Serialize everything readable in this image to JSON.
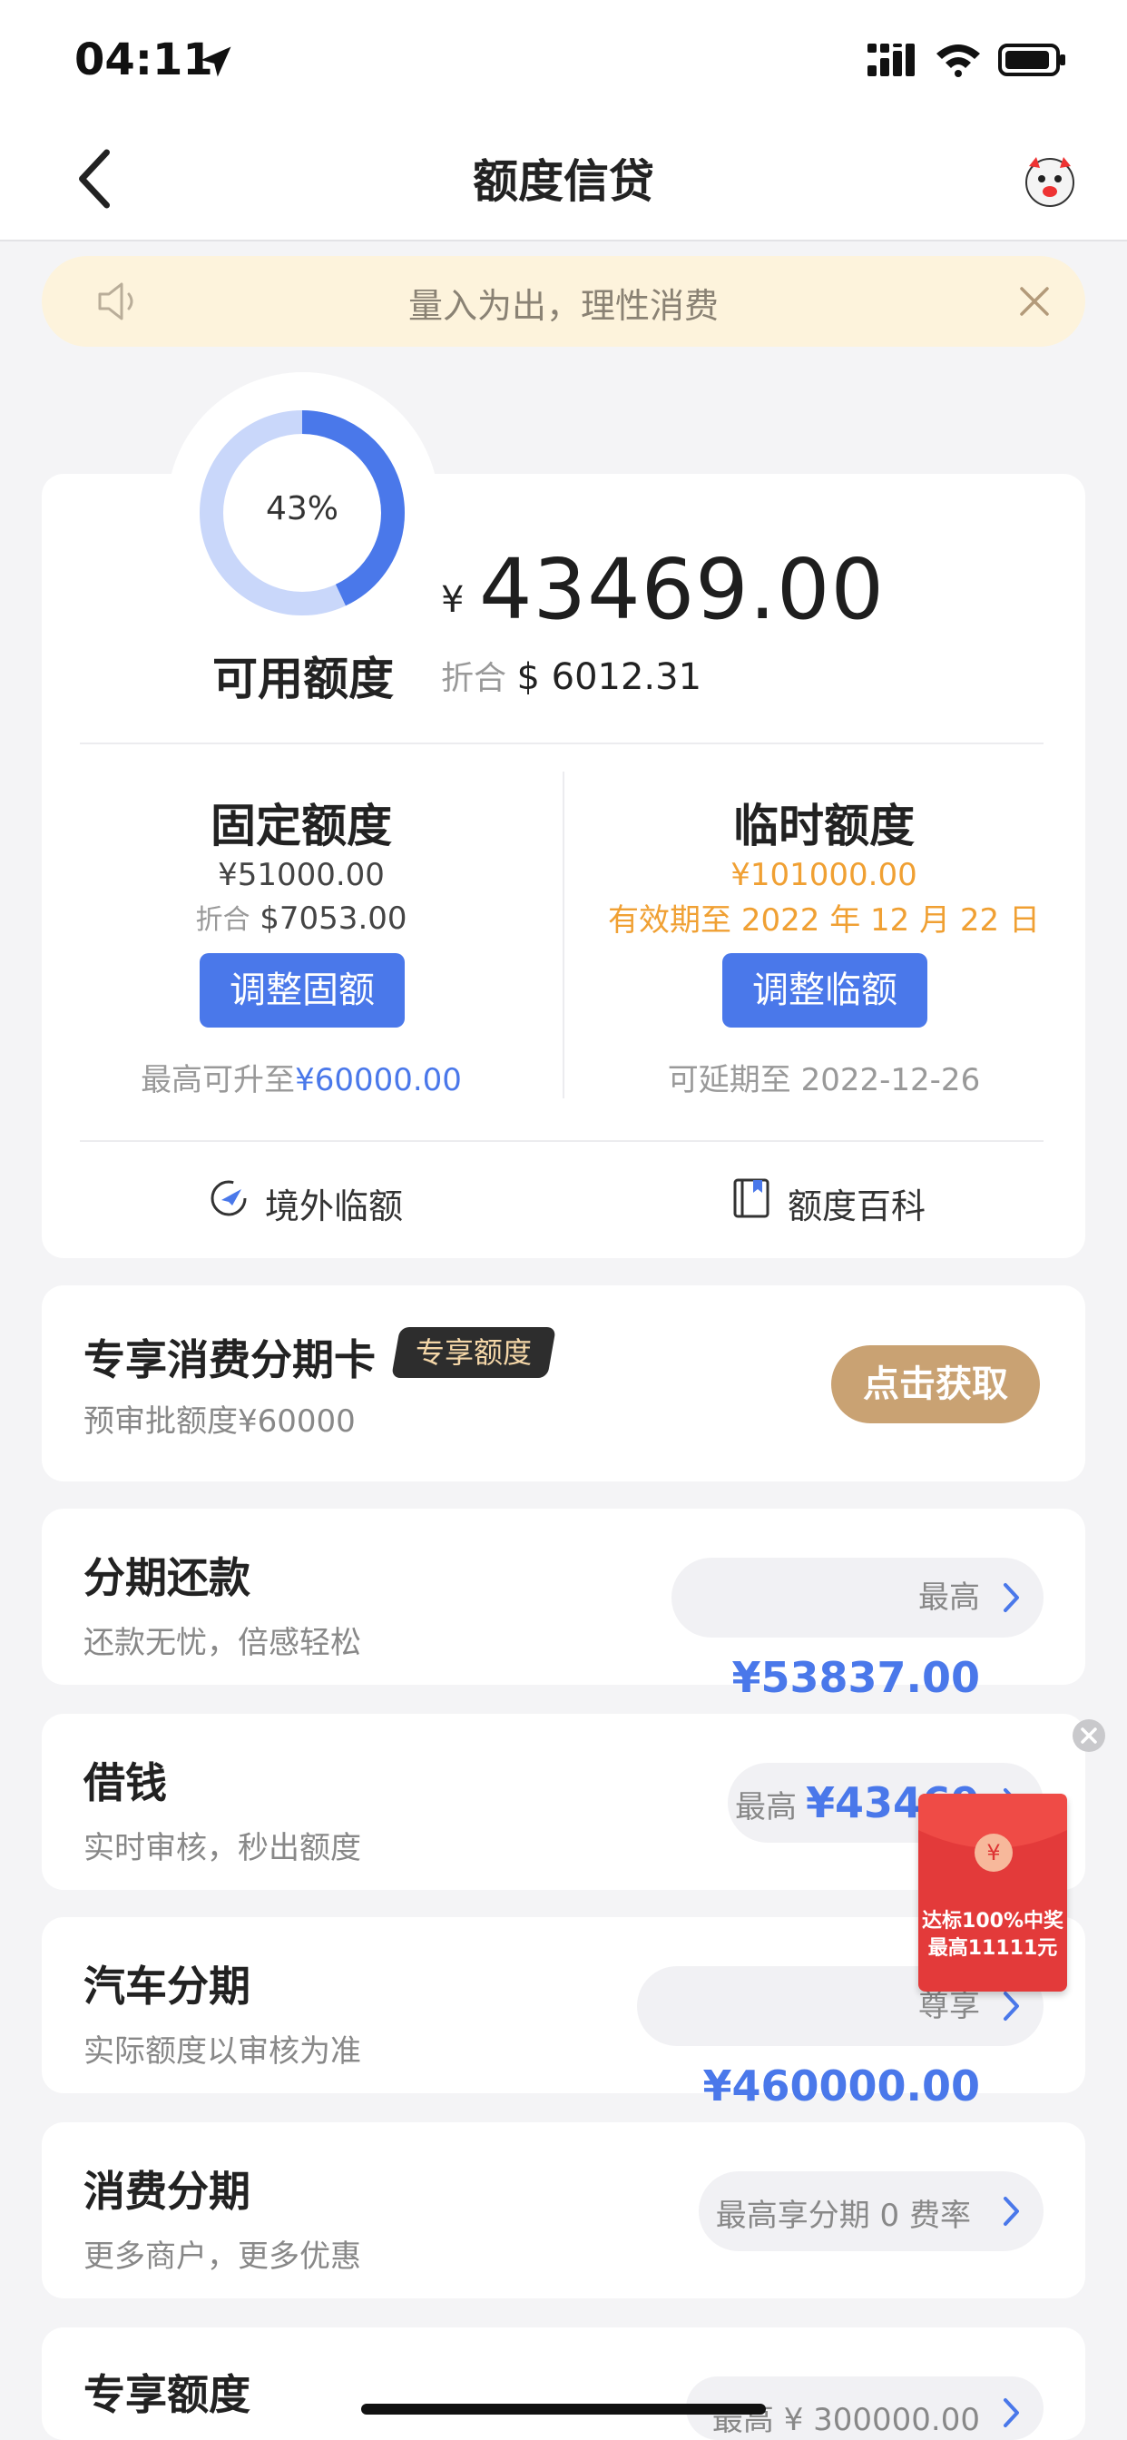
{
  "status_bar": {
    "time": "04:11"
  },
  "nav": {
    "title": "额度信贷"
  },
  "notice": {
    "text": "量入为出，理性消费"
  },
  "credit": {
    "percent_label": "43%",
    "percent_value": 0.43,
    "available_label": "可用额度",
    "currency_symbol": "¥",
    "available_amount": "43469.00",
    "fold_label": "折合",
    "fold_value": "$ 6012.31",
    "fixed": {
      "title": "固定额度",
      "amount": "¥51000.00",
      "fold_label": "折合",
      "fold_value": "$7053.00",
      "button": "调整固额",
      "foot_prefix": "最高可升至",
      "foot_value": "¥60000.00"
    },
    "temp": {
      "title": "临时额度",
      "amount": "¥101000.00",
      "validity": "有效期至 2022 年 12 月 22 日",
      "button": "调整临额",
      "foot": "可延期至 2022-12-26"
    },
    "links": {
      "overseas": "境外临额",
      "wiki": "额度百科"
    }
  },
  "exclusive_card": {
    "title": "专享消费分期卡",
    "badge": "专享额度",
    "sub": "预审批额度¥60000",
    "button": "点击获取"
  },
  "rows": [
    {
      "title": "分期还款",
      "sub": "还款无忧，倍感轻松",
      "pill_prefix": "最高",
      "pill_value": "¥53837.00"
    },
    {
      "title": "借钱",
      "sub": "实时审核，秒出额度",
      "pill_prefix": "最高",
      "pill_value": "¥43469"
    },
    {
      "title": "汽车分期",
      "sub": "实际额度以审核为准",
      "pill_prefix": "尊享",
      "pill_value": "¥460000.00"
    },
    {
      "title": "消费分期",
      "sub": "更多商户，更多优惠",
      "pill_prefix": "最高享分期 0 费率",
      "pill_value": ""
    },
    {
      "title": "专享额度",
      "sub": "",
      "pill_prefix": "最高 ¥ 300000.00",
      "pill_value": ""
    }
  ],
  "red_packet": {
    "line1": "达标100%中奖",
    "line2": "最高11111元",
    "coin": "¥"
  },
  "colors": {
    "accent_blue": "#4a78ea",
    "orange": "#f0a033",
    "gold": "#c9a273",
    "notice_bg": "#fdf3dc"
  }
}
